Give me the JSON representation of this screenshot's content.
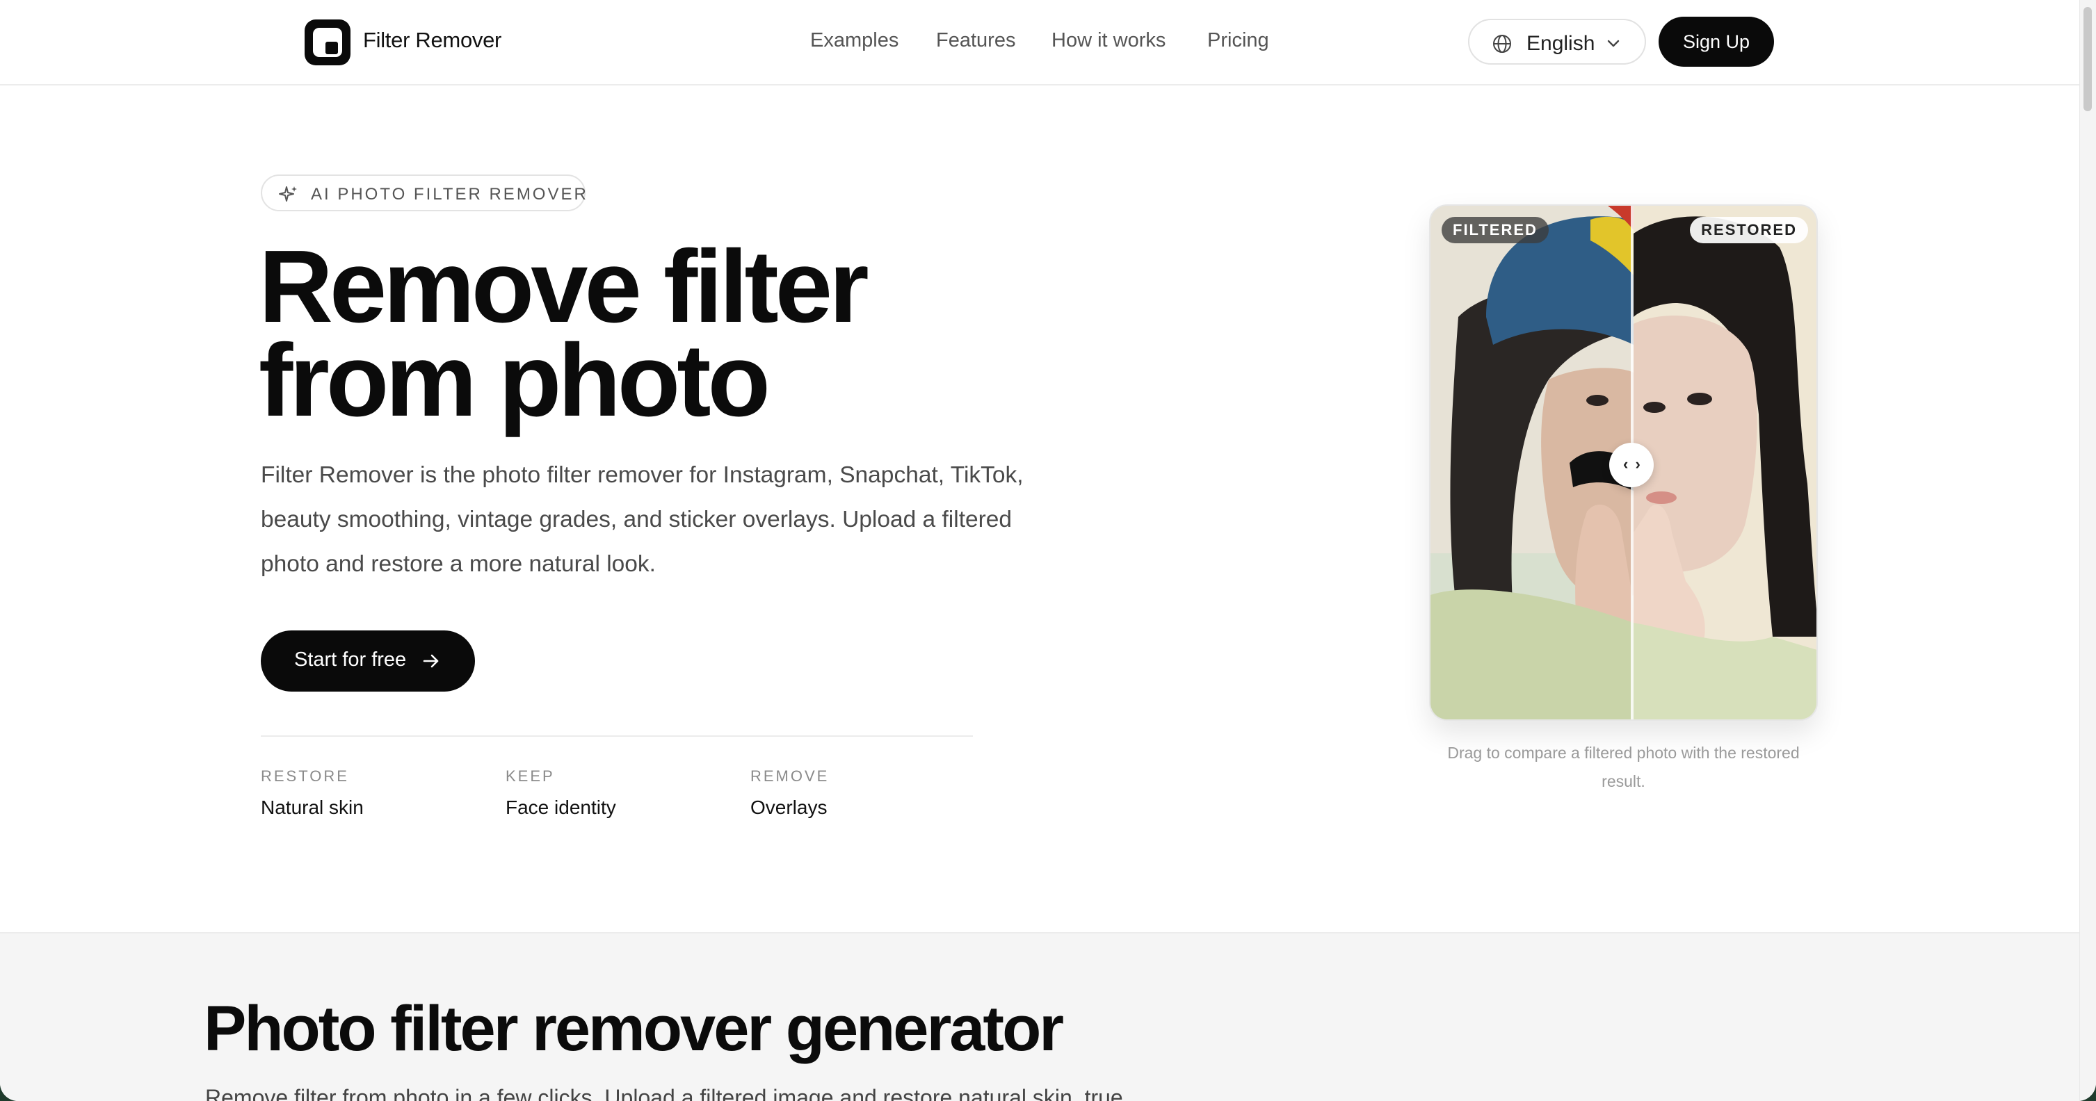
{
  "header": {
    "brand": "Filter Remover",
    "nav": [
      "Examples",
      "Features",
      "How it works",
      "Pricing"
    ],
    "language": "English",
    "signup_label": "Sign Up"
  },
  "hero": {
    "badge": "AI PHOTO FILTER REMOVER",
    "title_line1": "Remove filter",
    "title_line2": "from photo",
    "description": "Filter Remover is the photo filter remover for Instagram, Snapchat, TikTok, beauty smoothing, vintage grades, and sticker overlays. Upload a filtered photo and restore a more natural look.",
    "cta_label": "Start for free",
    "stats": [
      {
        "key": "RESTORE",
        "value": "Natural skin"
      },
      {
        "key": "KEEP",
        "value": "Face identity"
      },
      {
        "key": "REMOVE",
        "value": "Overlays"
      }
    ]
  },
  "compare": {
    "filtered_label": "FILTERED",
    "restored_label": "RESTORED",
    "handle_glyph": "‹ ›",
    "caption": "Drag to compare a filtered photo with the restored result.",
    "split_position": 0.52
  },
  "section2": {
    "title": "Photo filter remover generator",
    "subtitle": "Remove filter from photo in a few clicks. Upload a filtered image and restore natural skin, true"
  },
  "colors": {
    "primary": "#0a0a0a",
    "text_muted": "#555555",
    "section_bg": "#f5f5f5"
  }
}
